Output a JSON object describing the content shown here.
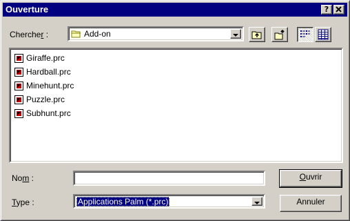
{
  "titlebar": {
    "title": "Ouverture",
    "help_glyph": "?",
    "close_glyph": "✕"
  },
  "lookin": {
    "label_pre": "Cherche",
    "label_mnemonic": "r",
    "label_post": " :",
    "value": "Add-on",
    "icon": "folder-icon"
  },
  "toolbar": {
    "buttons": [
      "up-folder-icon",
      "new-folder-icon",
      "list-view-icon",
      "details-view-icon"
    ]
  },
  "files": [
    {
      "name": "Giraffe.prc",
      "icon": "palm-app-icon"
    },
    {
      "name": "Hardball.prc",
      "icon": "palm-app-icon"
    },
    {
      "name": "Minehunt.prc",
      "icon": "palm-app-icon"
    },
    {
      "name": "Puzzle.prc",
      "icon": "palm-app-icon"
    },
    {
      "name": "Subhunt.prc",
      "icon": "palm-app-icon"
    }
  ],
  "filename": {
    "label_pre": "No",
    "label_mnemonic": "m",
    "label_post": " :",
    "value": ""
  },
  "filetype": {
    "label_pre": "",
    "label_mnemonic": "T",
    "label_post": "ype :",
    "value": "Applications Palm (*.prc)"
  },
  "buttons": {
    "open_mnemonic": "O",
    "open_rest": "uvrir",
    "cancel": "Annuler"
  },
  "colors": {
    "titlebar": "#000080",
    "face": "#d4d0c8",
    "selection": "#000080"
  }
}
